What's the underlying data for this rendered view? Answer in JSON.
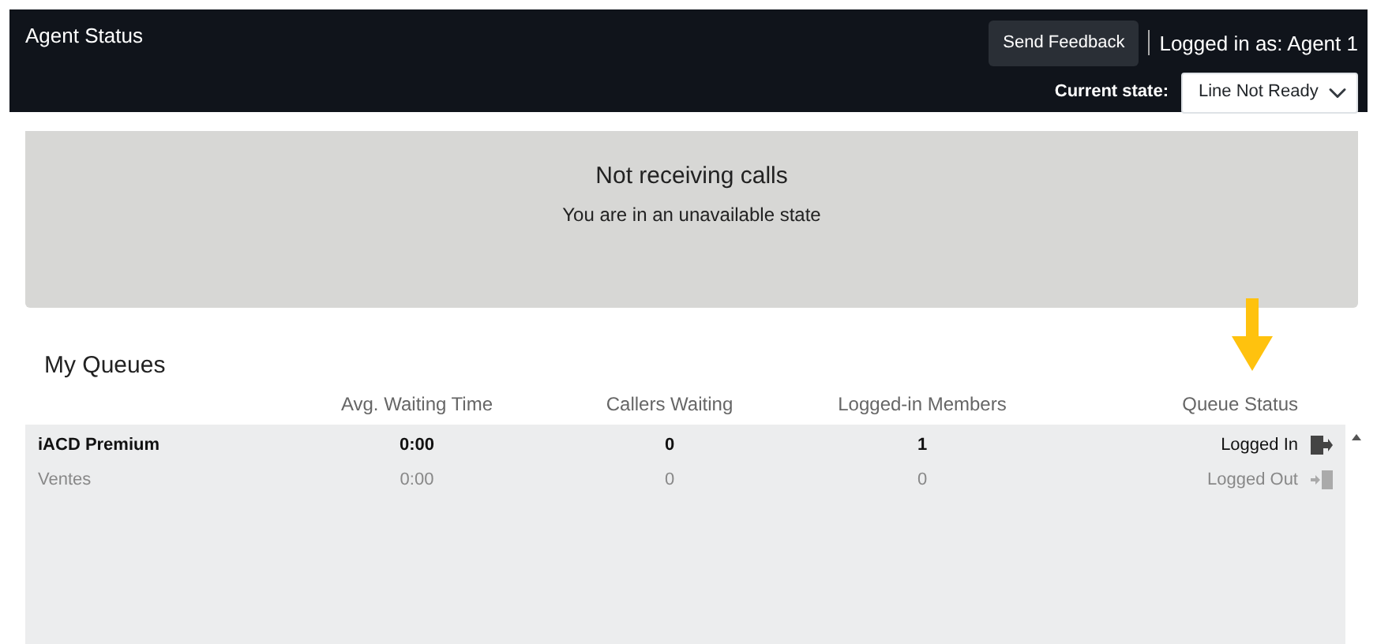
{
  "header": {
    "title": "Agent Status",
    "feedback_button": "Send Feedback",
    "logged_in_as": "Logged in as: Agent 1",
    "state_label": "Current state:",
    "state_value": "Line Not Ready"
  },
  "banner": {
    "title": "Not receiving calls",
    "subtitle": "You are in an unavailable state"
  },
  "queues": {
    "title": "My Queues",
    "columns": [
      "Avg. Waiting Time",
      "Callers Waiting",
      "Logged-in Members",
      "Queue Status"
    ],
    "rows": [
      {
        "name": "iACD Premium",
        "avg_wait": "0:00",
        "callers": "0",
        "members": "1",
        "status": "Logged In",
        "logged_in": true
      },
      {
        "name": "Ventes",
        "avg_wait": "0:00",
        "callers": "0",
        "members": "0",
        "status": "Logged Out",
        "logged_in": false
      }
    ]
  }
}
